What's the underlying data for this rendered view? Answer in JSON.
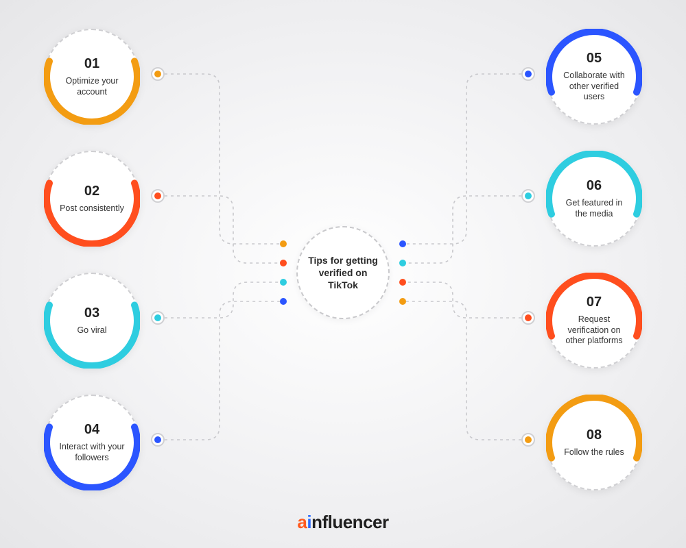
{
  "center": {
    "title": "Tips for getting verified on TikTok"
  },
  "colors": {
    "orange": "#f39c12",
    "red": "#ff4e1e",
    "cyan": "#2ecde0",
    "blue": "#2b55ff"
  },
  "tips": {
    "t1": {
      "num": "01",
      "label": "Optimize your account",
      "color": "orange"
    },
    "t2": {
      "num": "02",
      "label": "Post consistently",
      "color": "red"
    },
    "t3": {
      "num": "03",
      "label": "Go viral",
      "color": "cyan"
    },
    "t4": {
      "num": "04",
      "label": "Interact with your followers",
      "color": "blue"
    },
    "t5": {
      "num": "05",
      "label": "Collaborate with other verified users",
      "color": "blue"
    },
    "t6": {
      "num": "06",
      "label": "Get featured in the media",
      "color": "cyan"
    },
    "t7": {
      "num": "07",
      "label": "Request verification on other platforms",
      "color": "red"
    },
    "t8": {
      "num": "08",
      "label": "Follow the rules",
      "color": "orange"
    }
  },
  "logo": {
    "part1": "a",
    "part2": "i",
    "part3": "nfluencer"
  }
}
